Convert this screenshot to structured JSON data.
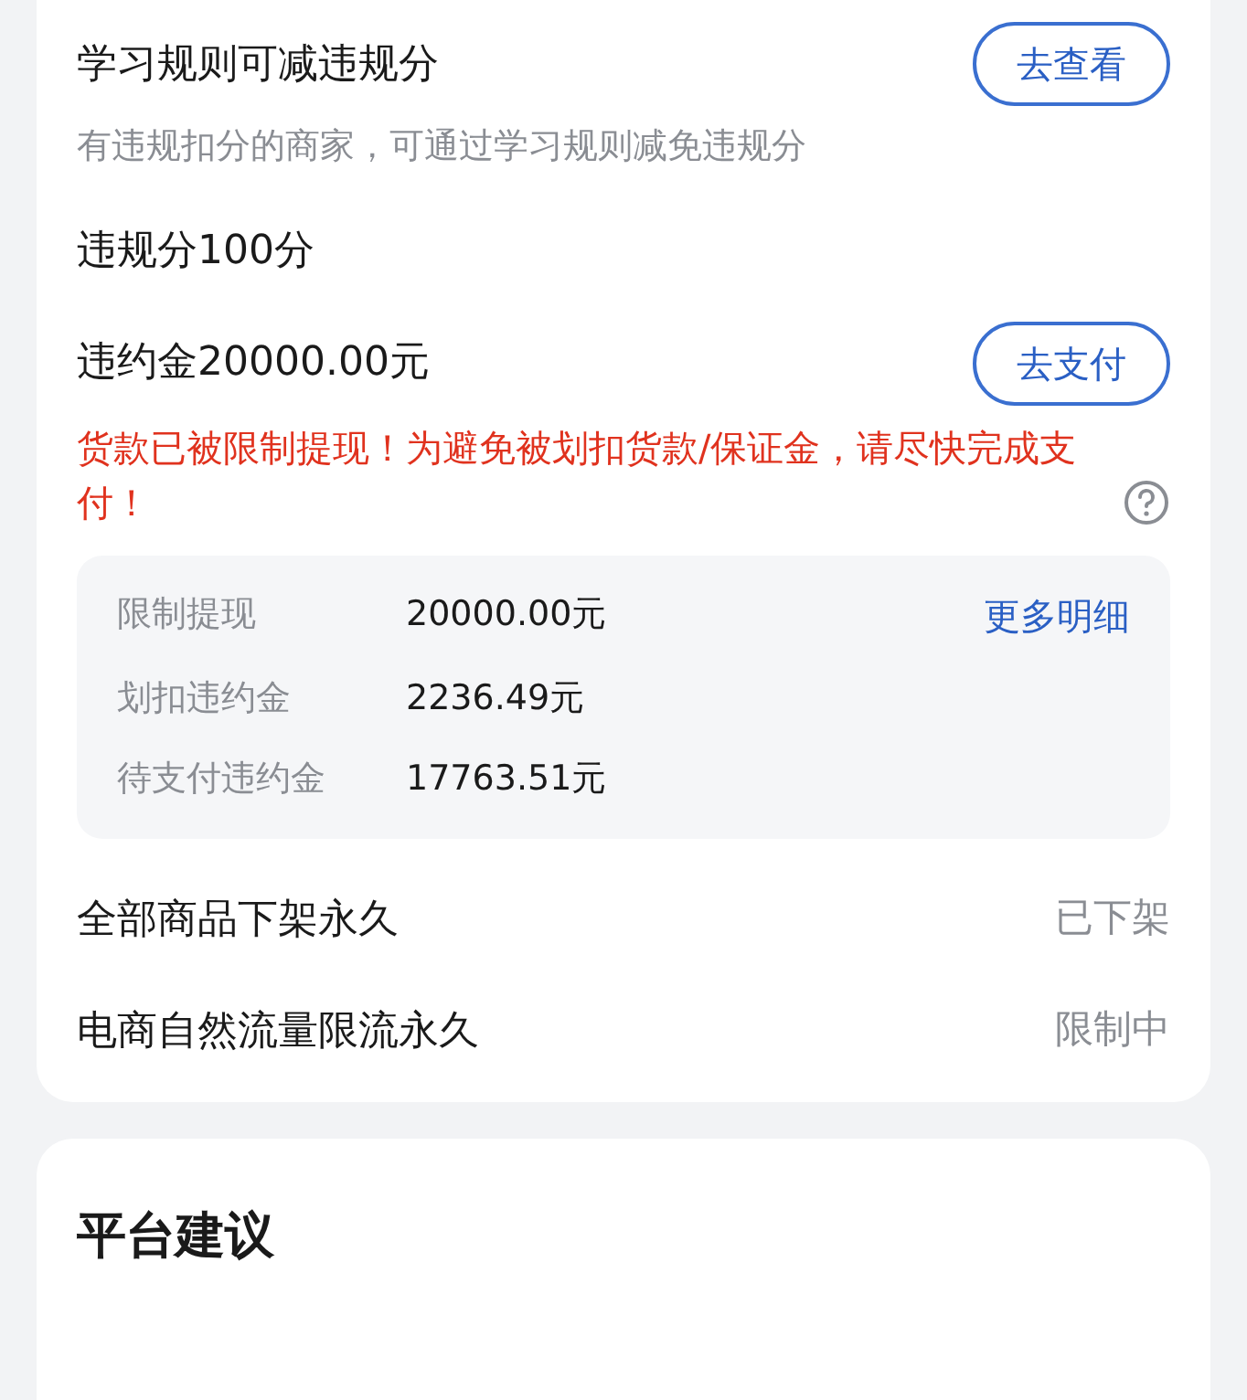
{
  "penalties": [
    {
      "kind": "action",
      "title": "学习规则可减违规分",
      "button": "去查看",
      "note": "有违规扣分的商家，可通过学习规则减免违规分"
    },
    {
      "kind": "plain",
      "title": "违规分100分"
    },
    {
      "kind": "fine",
      "title": "违约金20000.00元",
      "button": "去支付",
      "warning": "货款已被限制提现！为避免被划扣货款/保证金，请尽快完成支付！",
      "details": [
        {
          "label": "限制提现",
          "value": "20000.00元",
          "link": "更多明细"
        },
        {
          "label": "划扣违约金",
          "value": "2236.49元"
        },
        {
          "label": "待支付违约金",
          "value": "17763.51元"
        }
      ]
    },
    {
      "kind": "status",
      "title": "全部商品下架永久",
      "status": "已下架"
    },
    {
      "kind": "status",
      "title": "电商自然流量限流永久",
      "status": "限制中"
    }
  ],
  "suggestion": {
    "title": "平台建议"
  }
}
